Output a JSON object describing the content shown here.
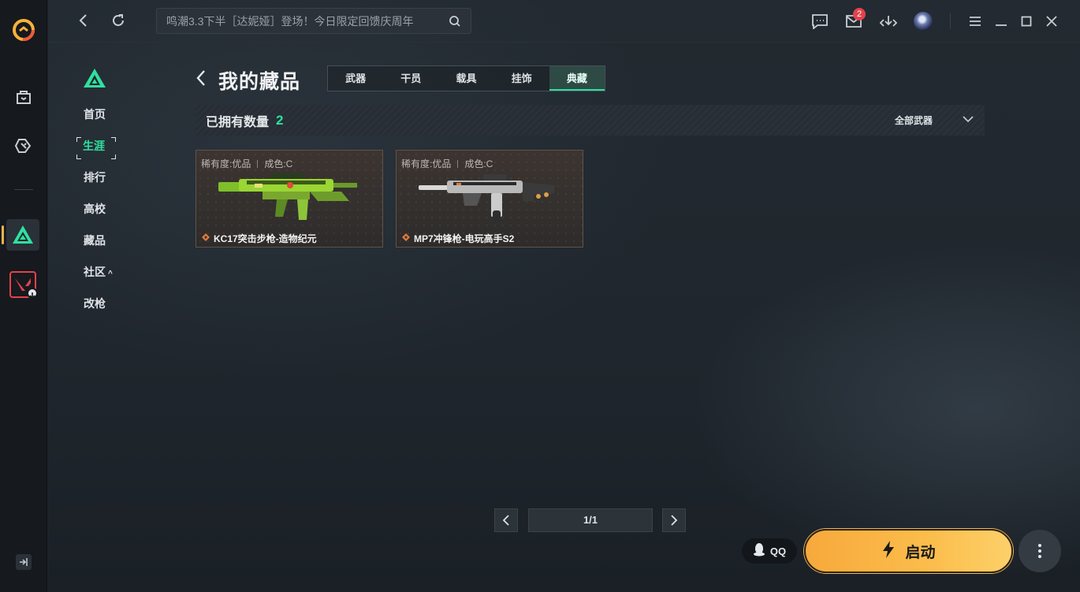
{
  "topbar": {
    "search_placeholder": "鸣潮3.3下半［达妮娅］登场！今日限定回馈庆周年",
    "mail_badge": "2"
  },
  "subnav": {
    "items": [
      {
        "label": "首页"
      },
      {
        "label": "生涯",
        "active": true
      },
      {
        "label": "排行"
      },
      {
        "label": "高校"
      },
      {
        "label": "藏品"
      },
      {
        "label": "社区",
        "caret": "^"
      },
      {
        "label": "改枪"
      }
    ]
  },
  "header": {
    "title": "我的藏品",
    "tabs": [
      {
        "label": "武器"
      },
      {
        "label": "干员"
      },
      {
        "label": "载具"
      },
      {
        "label": "挂饰"
      },
      {
        "label": "典藏",
        "active": true
      }
    ]
  },
  "summary": {
    "count_label": "已拥有数量",
    "count_value": "2",
    "filter_label": "全部武器"
  },
  "cards": [
    {
      "rarity": "稀有度:优品",
      "grade": "成色:C",
      "name": "KC17突击步枪-造物纪元"
    },
    {
      "rarity": "稀有度:优品",
      "grade": "成色:C",
      "name": "MP7冲锋枪-电玩高手S2"
    }
  ],
  "pagination": {
    "page_info": "1/1"
  },
  "bottom": {
    "qq_label": "QQ",
    "launch_label": "启动"
  },
  "colors": {
    "accent_green": "#2fe0a0",
    "launch_orange": "#fbbd4b",
    "badge_red": "#e2424c"
  }
}
